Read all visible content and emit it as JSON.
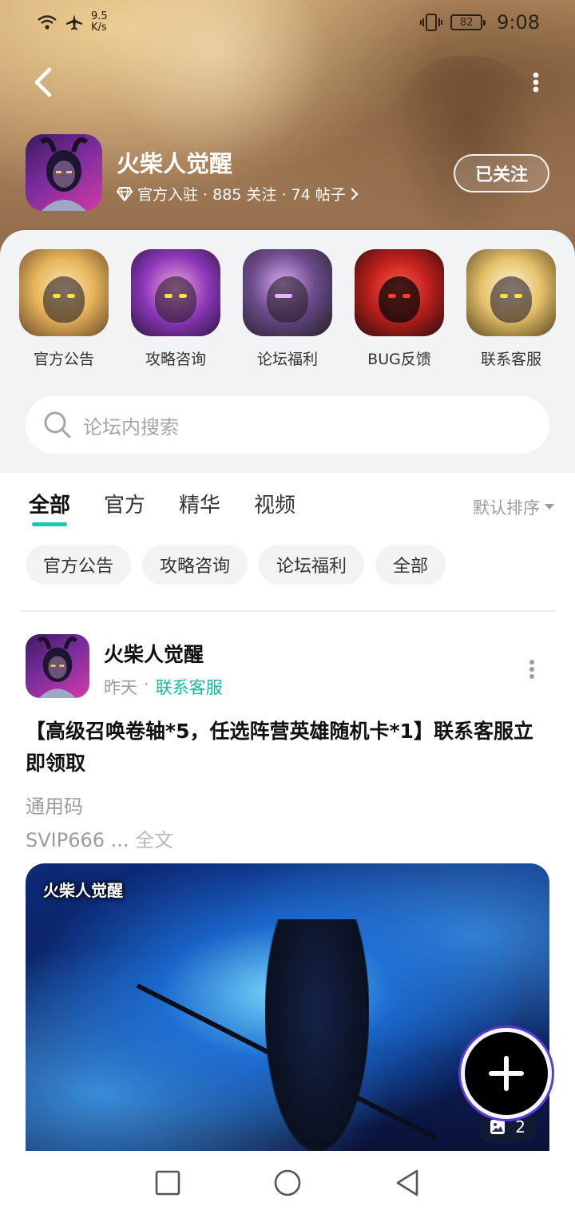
{
  "status_bar": {
    "net_speed": "9.5 K/s",
    "battery": "82",
    "time": "9:08"
  },
  "header": {
    "game_title": "火柴人觉醒",
    "meta": "官方入驻 · 885 关注 · 74 帖子",
    "follow_label": "已关注"
  },
  "quick_links": [
    {
      "label": "官方公告"
    },
    {
      "label": "攻略咨询"
    },
    {
      "label": "论坛福利"
    },
    {
      "label": "BUG反馈"
    },
    {
      "label": "联系客服"
    }
  ],
  "search": {
    "placeholder": "论坛内搜索"
  },
  "tabs": [
    {
      "label": "全部",
      "active": true
    },
    {
      "label": "官方"
    },
    {
      "label": "精华"
    },
    {
      "label": "视频"
    }
  ],
  "sort_label": "默认排序",
  "chips": [
    {
      "label": "官方公告"
    },
    {
      "label": "攻略咨询"
    },
    {
      "label": "论坛福利"
    },
    {
      "label": "全部"
    }
  ],
  "post": {
    "author": "火柴人觉醒",
    "time": "昨天",
    "board": "联系客服",
    "title": "【高级召唤卷轴*5，任选阵营英雄随机卡*1】联系客服立即领取",
    "body_line1": "通用码",
    "body_line2": "SVIP666",
    "ellipsis": " ... ",
    "fulltext_label": "全文",
    "image_logo": "火柴人觉醒",
    "image_count": "2"
  },
  "colors": {
    "accent": "#19c6b2",
    "board_link": "#14b8a6"
  }
}
